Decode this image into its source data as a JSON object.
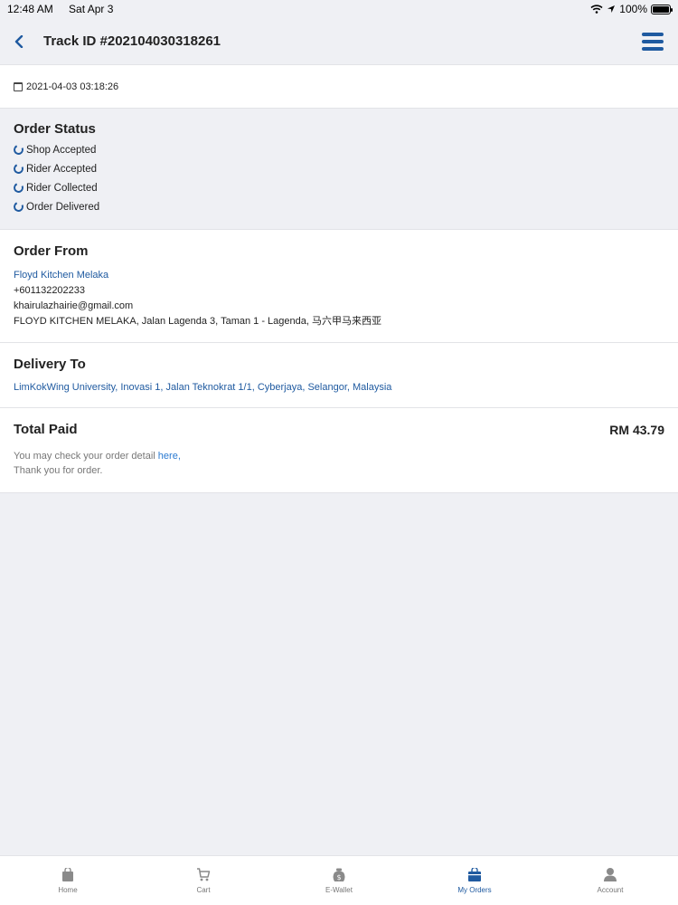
{
  "status_bar": {
    "time": "12:48 AM",
    "date": "Sat Apr 3",
    "battery": "100%"
  },
  "header": {
    "title": "Track ID #202104030318261"
  },
  "order_date": "2021-04-03 03:18:26",
  "order_status": {
    "title": "Order Status",
    "items": [
      "Shop Accepted",
      "Rider Accepted",
      "Rider Collected",
      "Order Delivered"
    ]
  },
  "order_from": {
    "title": "Order From",
    "shop_name": "Floyd Kitchen Melaka",
    "phone": "+601132202233",
    "email": "khairulazhairie@gmail.com",
    "address": "FLOYD KITCHEN MELAKA, Jalan Lagenda 3, Taman 1 - Lagenda, 马六甲马来西亚"
  },
  "delivery_to": {
    "title": "Delivery To",
    "address": "LimKokWing University, Inovasi 1, Jalan Teknokrat 1/1, Cyberjaya, Selangor, Malaysia"
  },
  "total": {
    "title": "Total Paid",
    "amount": "RM 43.79",
    "note_prefix": "You may check your order detail ",
    "note_link": "here,",
    "note_line2": "Thank you for order."
  },
  "tabs": [
    {
      "label": "Home",
      "icon": "bag-icon"
    },
    {
      "label": "Cart",
      "icon": "cart-icon"
    },
    {
      "label": "E-Wallet",
      "icon": "wallet-icon"
    },
    {
      "label": "My Orders",
      "icon": "orders-icon",
      "active": true
    },
    {
      "label": "Account",
      "icon": "account-icon"
    }
  ],
  "colors": {
    "accent": "#1f5aa0",
    "background": "#eff0f4",
    "link": "#2a7ad1"
  }
}
